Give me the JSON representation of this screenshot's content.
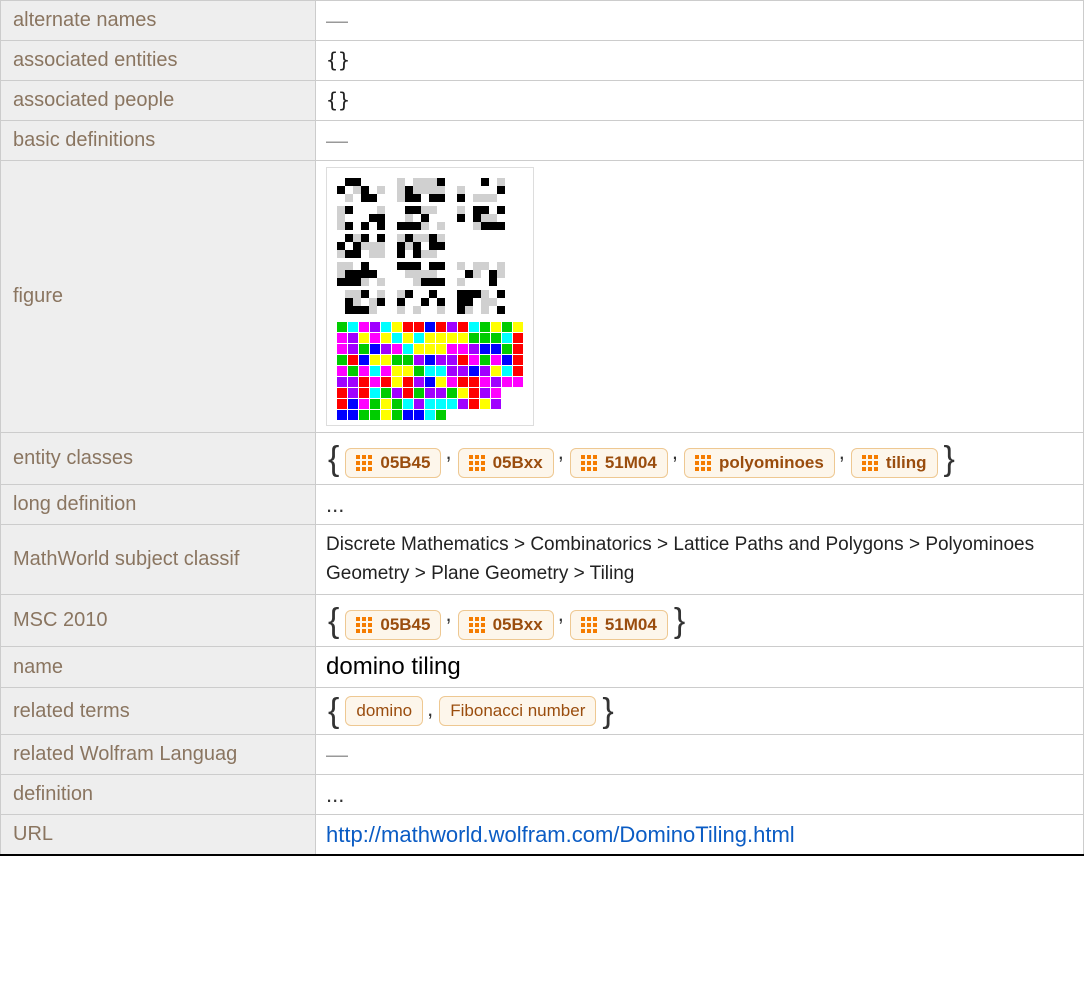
{
  "rows": {
    "alternate_names": {
      "label": "alternate names",
      "value": "—",
      "style": "dash"
    },
    "associated_entities": {
      "label": "associated entities",
      "value": "{}",
      "style": "braces"
    },
    "associated_people": {
      "label": "associated people",
      "value": "{}",
      "style": "braces"
    },
    "basic_definitions": {
      "label": "basic definitions",
      "value": "—",
      "style": "dash"
    },
    "figure": {
      "label": "figure"
    },
    "entity_classes": {
      "label": "entity classes",
      "chips": [
        {
          "label": "05B45",
          "icon": true
        },
        {
          "label": "05Bxx",
          "icon": true
        },
        {
          "label": "51M04",
          "icon": true
        },
        {
          "label": "polyominoes",
          "icon": true
        },
        {
          "label": "tiling",
          "icon": true
        }
      ]
    },
    "long_definition": {
      "label": "long definition",
      "value": "...",
      "style": "ellipsis"
    },
    "mathworld_subject": {
      "label": "MathWorld subject classif",
      "lines": [
        "Discrete Mathematics > Combinatorics > Lattice Paths and Polygons > Polyominoes",
        "Geometry > Plane Geometry > Tiling"
      ]
    },
    "msc_2010": {
      "label": "MSC 2010",
      "chips": [
        {
          "label": "05B45",
          "icon": true
        },
        {
          "label": "05Bxx",
          "icon": true
        },
        {
          "label": "51M04",
          "icon": true
        }
      ]
    },
    "name": {
      "label": "name",
      "value": "domino tiling"
    },
    "related_terms": {
      "label": "related terms",
      "chips": [
        {
          "label": "domino",
          "icon": false
        },
        {
          "label": "Fibonacci number",
          "icon": false
        }
      ]
    },
    "related_wl": {
      "label": "related Wolfram Languag",
      "value": "—",
      "style": "dash"
    },
    "definition": {
      "label": "definition",
      "value": "...",
      "style": "ellipsis"
    },
    "url": {
      "label": "URL",
      "value": "http://mathworld.wolfram.com/DominoTiling.html"
    }
  }
}
